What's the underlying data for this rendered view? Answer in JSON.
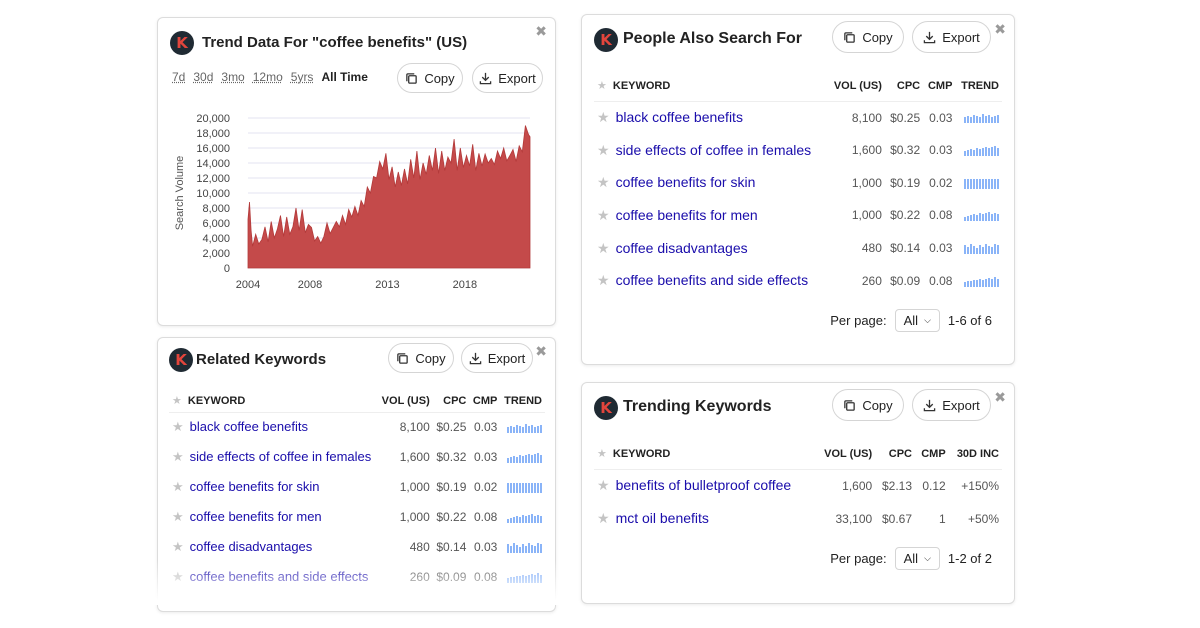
{
  "common": {
    "copy_label": "Copy",
    "export_label": "Export",
    "close_glyph": "✖",
    "logo_letter": "K",
    "per_page_label": "Per page:",
    "per_page_value": "All"
  },
  "trend": {
    "title": "Trend Data For \"coffee benefits\" (US)",
    "filters": [
      {
        "label": "7d",
        "active": false
      },
      {
        "label": "30d",
        "active": false
      },
      {
        "label": "3mo",
        "active": false
      },
      {
        "label": "12mo",
        "active": false
      },
      {
        "label": "5yrs",
        "active": false
      },
      {
        "label": "All Time",
        "active": true
      }
    ]
  },
  "chart_data": {
    "type": "area",
    "title": "",
    "xlabel": "",
    "ylabel": "Search Volume",
    "ylim": [
      0,
      20000
    ],
    "yticks": [
      "20,000",
      "18,000",
      "16,000",
      "14,000",
      "12,000",
      "10,000",
      "8,000",
      "6,000",
      "4,000",
      "2,000",
      "0"
    ],
    "xticks": [
      {
        "label": "2004",
        "value": 2004
      },
      {
        "label": "2008",
        "value": 2008
      },
      {
        "label": "2013",
        "value": 2013
      },
      {
        "label": "2018",
        "value": 2018
      }
    ],
    "xlim": [
      2004,
      2022.2
    ],
    "grid": true,
    "color": "#c44a4a",
    "x": [
      2004.0,
      2004.1,
      2004.2,
      2004.3,
      2004.5,
      2004.7,
      2004.9,
      2005.1,
      2005.3,
      2005.5,
      2005.7,
      2005.9,
      2006.1,
      2006.3,
      2006.5,
      2006.7,
      2006.9,
      2007.1,
      2007.3,
      2007.5,
      2007.7,
      2007.9,
      2008.1,
      2008.3,
      2008.5,
      2008.7,
      2008.9,
      2009.1,
      2009.3,
      2009.5,
      2009.7,
      2009.9,
      2010.1,
      2010.3,
      2010.5,
      2010.7,
      2010.9,
      2011.1,
      2011.3,
      2011.5,
      2011.7,
      2011.9,
      2012.1,
      2012.3,
      2012.5,
      2012.7,
      2012.9,
      2013.1,
      2013.3,
      2013.5,
      2013.7,
      2013.9,
      2014.1,
      2014.3,
      2014.5,
      2014.7,
      2014.9,
      2015.1,
      2015.3,
      2015.5,
      2015.7,
      2015.9,
      2016.1,
      2016.3,
      2016.5,
      2016.7,
      2016.9,
      2017.1,
      2017.3,
      2017.5,
      2017.7,
      2017.9,
      2018.1,
      2018.3,
      2018.5,
      2018.7,
      2018.9,
      2019.1,
      2019.3,
      2019.5,
      2019.7,
      2019.9,
      2020.1,
      2020.3,
      2020.5,
      2020.7,
      2020.9,
      2021.1,
      2021.3,
      2021.5,
      2021.7,
      2021.9,
      2022.1,
      2022.2
    ],
    "y": [
      6500,
      8800,
      5000,
      2900,
      4500,
      3200,
      3800,
      5500,
      3500,
      6200,
      4000,
      5200,
      7000,
      4200,
      6800,
      4500,
      5500,
      8000,
      5000,
      7800,
      4700,
      5800,
      5400,
      3600,
      4200,
      3300,
      4200,
      6000,
      4600,
      5400,
      6200,
      5500,
      7000,
      5800,
      7800,
      6800,
      8200,
      7000,
      9000,
      8200,
      10800,
      10000,
      12200,
      12000,
      14200,
      13200,
      15300,
      11800,
      13500,
      10800,
      12800,
      11000,
      13200,
      11200,
      14500,
      12000,
      15600,
      11800,
      14000,
      12500,
      15000,
      13000,
      16000,
      12600,
      15600,
      13000,
      14800,
      14000,
      17200,
      13000,
      16000,
      13400,
      15000,
      13600,
      16500,
      13000,
      15300,
      13600,
      15200,
      14000,
      14600,
      13800,
      15600,
      14600,
      16000,
      14300,
      15000,
      15800,
      14200,
      16300,
      15500,
      19000,
      17800,
      17500
    ]
  },
  "related": {
    "title": "Related Keywords",
    "columns": [
      "KEYWORD",
      "VOL (US)",
      "CPC",
      "CMP",
      "TREND"
    ],
    "rows": [
      {
        "keyword": "black coffee benefits",
        "vol": "8,100",
        "cpc": "$0.25",
        "cmp": "0.03",
        "trend": [
          0.6,
          0.7,
          0.6,
          0.8,
          0.7,
          0.6,
          0.9,
          0.7,
          0.8,
          0.6,
          0.7,
          0.8
        ]
      },
      {
        "keyword": "side effects of coffee in females",
        "vol": "1,600",
        "cpc": "$0.32",
        "cmp": "0.03",
        "trend": [
          0.5,
          0.6,
          0.7,
          0.6,
          0.8,
          0.7,
          0.8,
          0.9,
          0.8,
          0.9,
          1.0,
          0.8
        ]
      },
      {
        "keyword": "coffee benefits for skin",
        "vol": "1,000",
        "cpc": "$0.19",
        "cmp": "0.02",
        "trend": [
          1,
          1,
          1,
          1,
          1,
          1,
          1,
          1,
          1,
          1,
          1,
          1
        ]
      },
      {
        "keyword": "coffee benefits for men",
        "vol": "1,000",
        "cpc": "$0.22",
        "cmp": "0.08",
        "trend": [
          0.4,
          0.5,
          0.6,
          0.7,
          0.6,
          0.8,
          0.7,
          0.8,
          0.9,
          0.7,
          0.8,
          0.7
        ]
      },
      {
        "keyword": "coffee disadvantages",
        "vol": "480",
        "cpc": "$0.14",
        "cmp": "0.03",
        "trend": [
          0.9,
          0.7,
          1.0,
          0.8,
          0.6,
          0.9,
          0.7,
          1.0,
          0.8,
          0.7,
          1.0,
          0.9
        ]
      },
      {
        "keyword": "coffee benefits and side effects",
        "vol": "260",
        "cpc": "$0.09",
        "cmp": "0.08",
        "trend": [
          0.5,
          0.6,
          0.6,
          0.7,
          0.7,
          0.8,
          0.7,
          0.8,
          0.9,
          0.8,
          1.0,
          0.8
        ]
      }
    ]
  },
  "people": {
    "title": "People Also Search For",
    "columns": [
      "KEYWORD",
      "VOL (US)",
      "CPC",
      "CMP",
      "TREND"
    ],
    "rows": [
      {
        "keyword": "black coffee benefits",
        "vol": "8,100",
        "cpc": "$0.25",
        "cmp": "0.03",
        "trend": [
          0.6,
          0.7,
          0.6,
          0.8,
          0.7,
          0.6,
          0.9,
          0.7,
          0.8,
          0.6,
          0.7,
          0.8
        ]
      },
      {
        "keyword": "side effects of coffee in females",
        "vol": "1,600",
        "cpc": "$0.32",
        "cmp": "0.03",
        "trend": [
          0.5,
          0.6,
          0.7,
          0.6,
          0.8,
          0.7,
          0.8,
          0.9,
          0.8,
          0.9,
          1.0,
          0.8
        ]
      },
      {
        "keyword": "coffee benefits for skin",
        "vol": "1,000",
        "cpc": "$0.19",
        "cmp": "0.02",
        "trend": [
          1,
          1,
          1,
          1,
          1,
          1,
          1,
          1,
          1,
          1,
          1,
          1
        ]
      },
      {
        "keyword": "coffee benefits for men",
        "vol": "1,000",
        "cpc": "$0.22",
        "cmp": "0.08",
        "trend": [
          0.4,
          0.5,
          0.6,
          0.7,
          0.6,
          0.8,
          0.7,
          0.8,
          0.9,
          0.7,
          0.8,
          0.7
        ]
      },
      {
        "keyword": "coffee disadvantages",
        "vol": "480",
        "cpc": "$0.14",
        "cmp": "0.03",
        "trend": [
          0.9,
          0.7,
          1.0,
          0.8,
          0.6,
          0.9,
          0.7,
          1.0,
          0.8,
          0.7,
          1.0,
          0.9
        ]
      },
      {
        "keyword": "coffee benefits and side effects",
        "vol": "260",
        "cpc": "$0.09",
        "cmp": "0.08",
        "trend": [
          0.5,
          0.6,
          0.6,
          0.7,
          0.7,
          0.8,
          0.7,
          0.8,
          0.9,
          0.8,
          1.0,
          0.8
        ]
      }
    ],
    "pagination": "1-6 of 6"
  },
  "trending": {
    "title": "Trending Keywords",
    "columns": [
      "KEYWORD",
      "VOL (US)",
      "CPC",
      "CMP",
      "30D INC"
    ],
    "rows": [
      {
        "keyword": "benefits of bulletproof coffee",
        "vol": "1,600",
        "cpc": "$2.13",
        "cmp": "0.12",
        "inc": "+150%"
      },
      {
        "keyword": "mct oil benefits",
        "vol": "33,100",
        "cpc": "$0.67",
        "cmp": "1",
        "inc": "+50%"
      }
    ],
    "pagination": "1-2 of 2"
  }
}
